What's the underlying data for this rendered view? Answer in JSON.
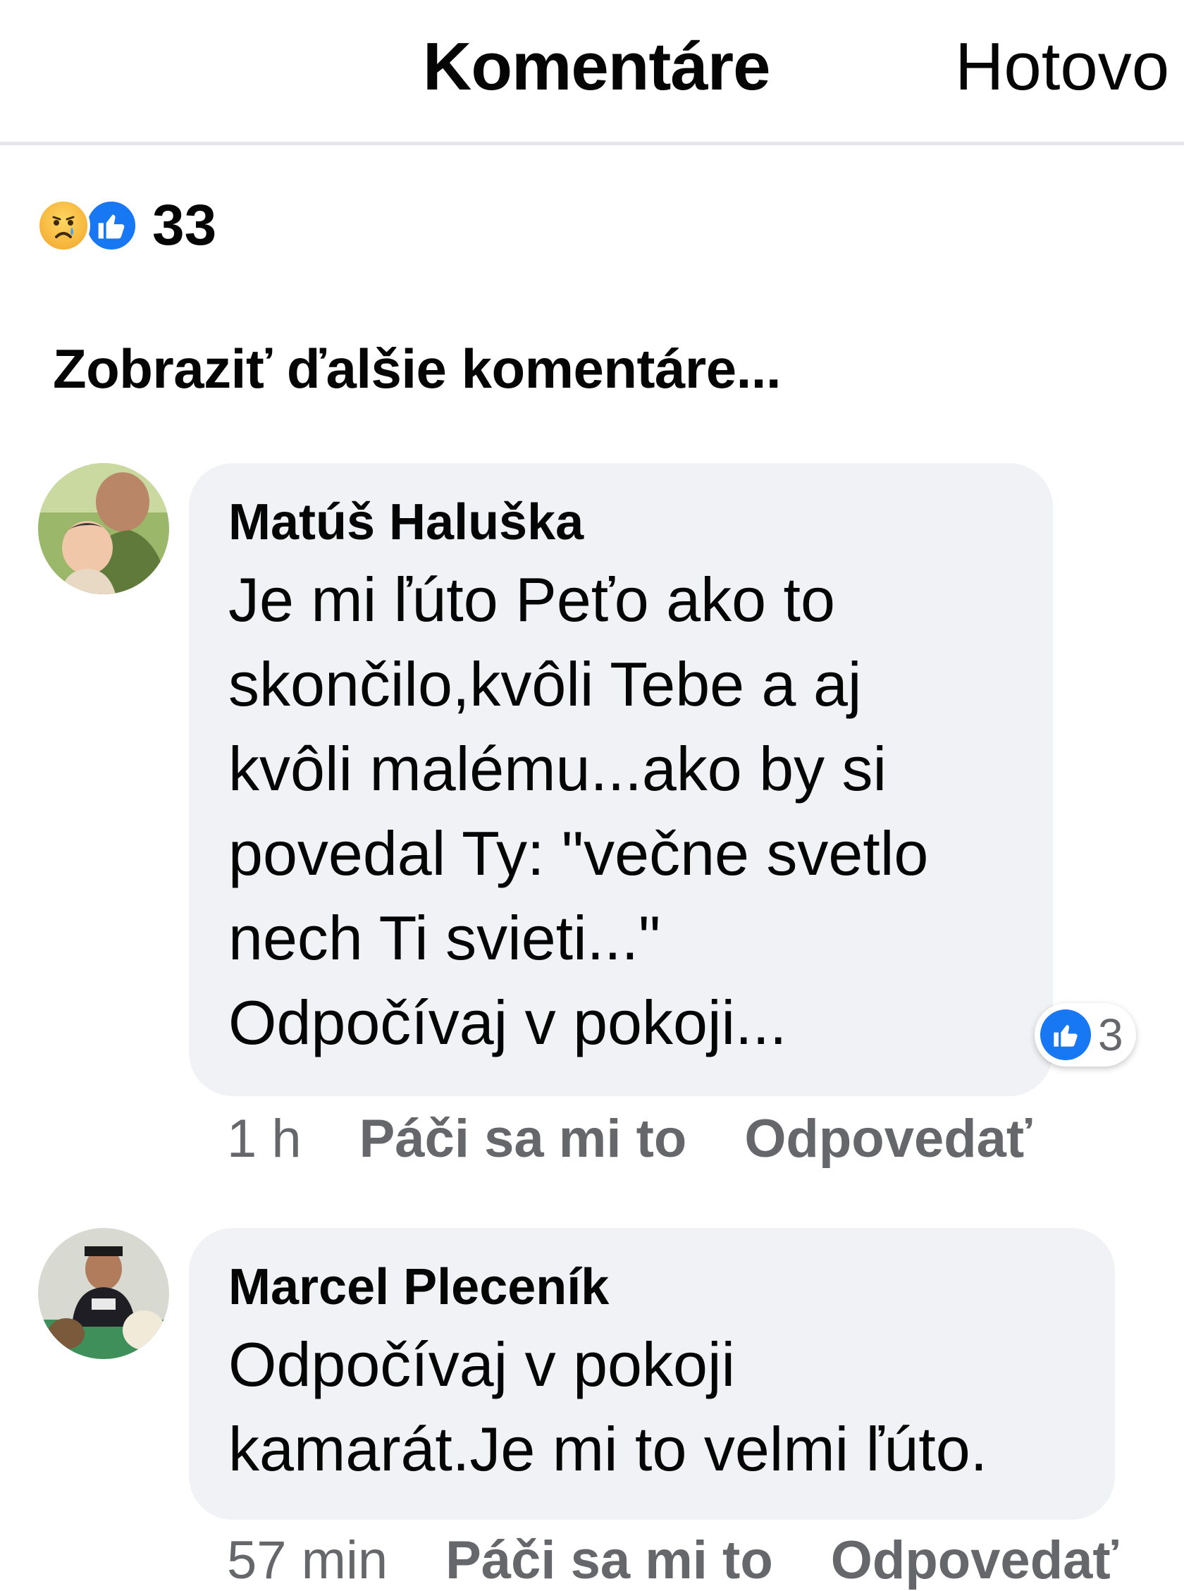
{
  "header": {
    "title": "Komentáre",
    "done": "Hotovo"
  },
  "reactions": {
    "icons": [
      "sad-face-icon",
      "thumbs-up-icon"
    ],
    "count": "33"
  },
  "more_comments_label": "Zobraziť ďalšie komentáre...",
  "comments": [
    {
      "author": "Matúš Haluška",
      "text": "Je mi ľúto Peťo ako to\nskončilo,kvôli Tebe a aj\nkvôli malému...ako by si\npovedal Ty: \"večne svetlo\nnech Ti svieti...\"\nOdpočívaj v pokoji...",
      "likes": "3",
      "time": "1 h",
      "like_action": "Páči sa mi to",
      "reply_action": "Odpovedať"
    },
    {
      "author": "Marcel Pleceník",
      "text": "Odpočívaj v pokoji\nkamarát.Je mi to velmi ľúto.",
      "time": "57 min",
      "like_action": "Páči sa mi to",
      "reply_action": "Odpovedať"
    }
  ],
  "colors": {
    "accent": "#1877f2",
    "bubble": "#f0f2f5",
    "meta_text": "#65676b"
  }
}
